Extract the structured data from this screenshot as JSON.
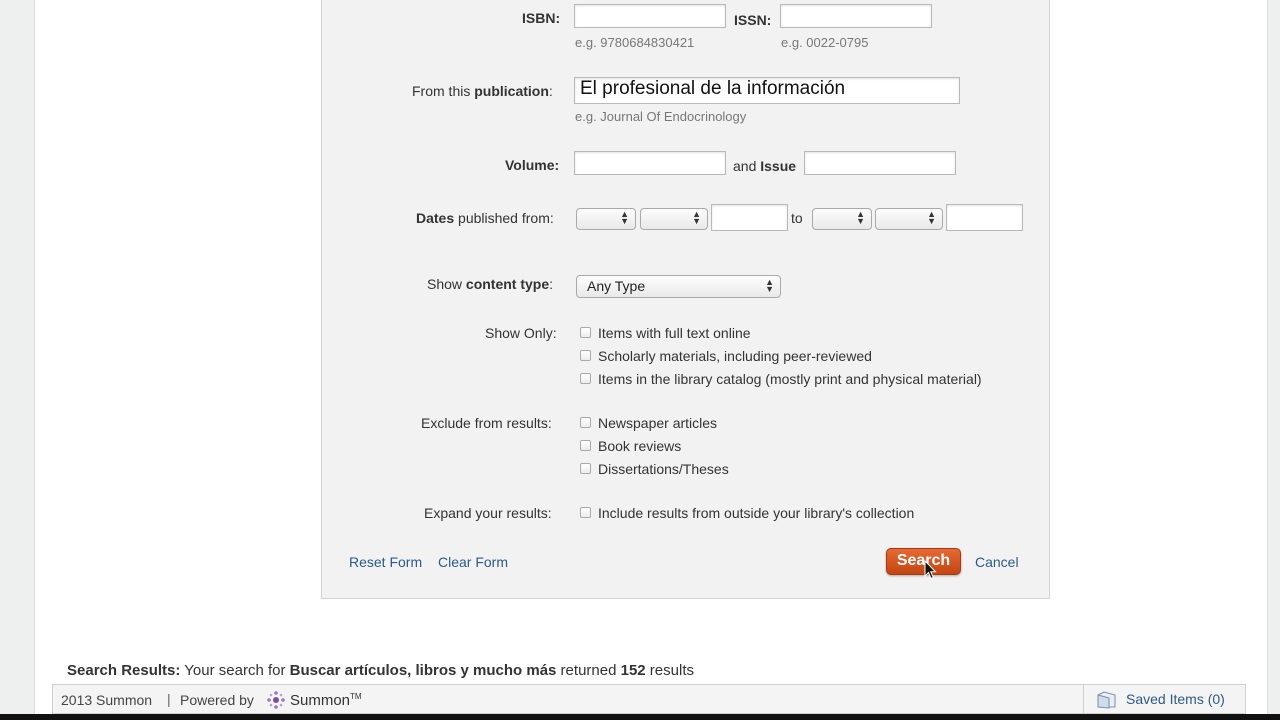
{
  "form": {
    "isbn_label": "ISBN:",
    "isbn_value": "",
    "isbn_hint": "e.g. 9780684830421",
    "issn_label": "ISSN:",
    "issn_value": "",
    "issn_hint": "e.g. 0022-0795",
    "publication_label_prefix": "From this ",
    "publication_label_bold": "publication",
    "publication_label_suffix": ":",
    "publication_value": "El profesional de la información",
    "publication_hint": "e.g. Journal Of Endocrinology",
    "volume_label": "Volume:",
    "volume_value": "",
    "and_label": "and ",
    "issue_label": "Issue",
    "issue_value": "",
    "dates_label_bold": "Dates",
    "dates_label_rest": " published from:",
    "to_label": "to",
    "date_from_year": "",
    "date_to_year": "",
    "content_type_prefix": "Show ",
    "content_type_bold": "content type",
    "content_type_suffix": ":",
    "content_type_value": "Any Type",
    "show_only_label": "Show Only:",
    "show_only_options": [
      "Items with full text online",
      "Scholarly materials, including peer-reviewed",
      "Items in the library catalog (mostly print and physical material)"
    ],
    "exclude_label": "Exclude from results:",
    "exclude_options": [
      "Newspaper articles",
      "Book reviews",
      "Dissertations/Theses"
    ],
    "expand_label": "Expand your results:",
    "expand_option": "Include results from outside your library's collection",
    "reset_label": "Reset Form",
    "clear_label": "Clear Form",
    "search_label": "Search",
    "cancel_label": "Cancel"
  },
  "results": {
    "prefix_bold": "Search Results:",
    "text1": " Your search for ",
    "query": "Buscar artículos, libros y mucho más",
    "text2": " returned ",
    "count": "152",
    "text3": " results"
  },
  "footer": {
    "copyright": "2013 Summon",
    "separator": "|",
    "powered_by": "Powered by",
    "brand": "Summon",
    "brand_tm": "TM",
    "saved_items": "Saved Items (0)"
  },
  "colors": {
    "search_button": "#d6531f",
    "link": "#2b5a8a"
  }
}
